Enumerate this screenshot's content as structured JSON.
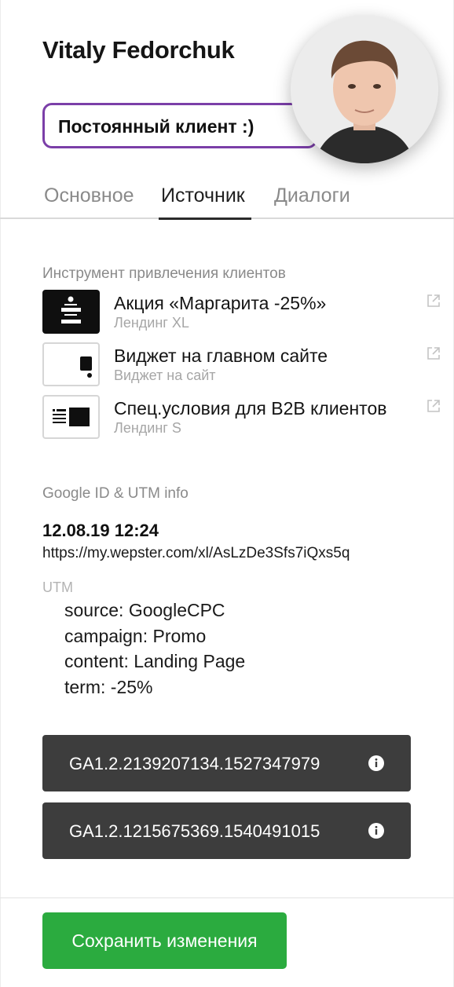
{
  "profile": {
    "name": "Vitaly Fedorchuk",
    "status": "Постоянный клиент :)"
  },
  "tabs": [
    {
      "label": "Основное"
    },
    {
      "label": "Источник"
    },
    {
      "label": "Диалоги"
    }
  ],
  "active_tab": "Источник",
  "tools": {
    "label": "Инструмент привлечения клиентов",
    "items": [
      {
        "title": "Акция «Маргарита -25%»",
        "subtitle": "Лендинг XL",
        "icon": "landing-xl-icon"
      },
      {
        "title": "Виджет на главном сайте",
        "subtitle": "Виджет на сайт",
        "icon": "widget-icon"
      },
      {
        "title": "Спец.условия для B2B клиентов",
        "subtitle": "Лендинг S",
        "icon": "landing-s-icon"
      }
    ]
  },
  "google": {
    "label": "Google ID & UTM info",
    "date": "12.08.19 12:24",
    "url": "https://my.wepster.com/xl/AsLzDe3Sfs7iQxs5q",
    "utm_label": "UTM",
    "utm": [
      "source: GoogleCPC",
      "campaign: Promo",
      "content: Landing Page",
      "term: -25%"
    ],
    "ga_ids": [
      "GA1.2.2139207134.1527347979",
      "GA1.2.1215675369.1540491015"
    ]
  },
  "save_label": "Сохранить изменения",
  "colors": {
    "accent_purple": "#7b3fa8",
    "save_green": "#2bab3f",
    "ga_button": "#3d3d3d"
  }
}
